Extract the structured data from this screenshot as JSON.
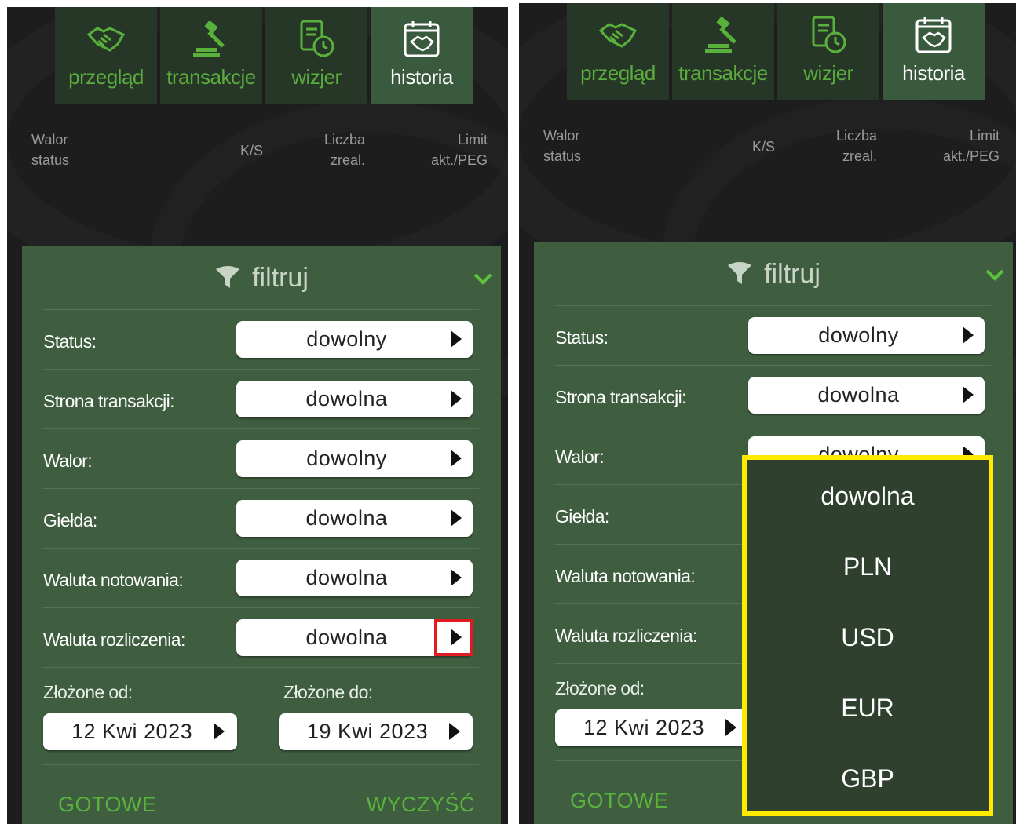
{
  "tabs": [
    {
      "label": "przegląd",
      "icon": "handshake-icon"
    },
    {
      "label": "transakcje",
      "icon": "gavel-icon"
    },
    {
      "label": "wizjer",
      "icon": "document-clock-icon"
    },
    {
      "label": "historia",
      "icon": "calendar-handshake-icon",
      "active": true
    }
  ],
  "columns": {
    "walor": "Walor",
    "status": "status",
    "ks": "K/S",
    "liczba": "Liczba",
    "zreal": "zreal.",
    "limit": "Limit",
    "akt_peg": "akt./PEG"
  },
  "filter": {
    "title": "filtruj",
    "rows": [
      {
        "label": "Status:",
        "value": "dowolny"
      },
      {
        "label": "Strona transakcji:",
        "value": "dowolna"
      },
      {
        "label": "Walor:",
        "value": "dowolny"
      },
      {
        "label": "Giełda:",
        "value": "dowolna"
      },
      {
        "label": "Waluta notowania:",
        "value": "dowolna"
      },
      {
        "label": "Waluta rozliczenia:",
        "value": "dowolna"
      }
    ],
    "from_label": "Złożone od:",
    "to_label": "Złożone do:",
    "from_date": "12 Kwi 2023",
    "to_date": "19 Kwi 2023",
    "done": "GOTOWE",
    "clear": "WYCZYŚĆ"
  },
  "dropdown": {
    "options": [
      "dowolna",
      "PLN",
      "USD",
      "EUR",
      "GBP"
    ]
  },
  "colors": {
    "panel": "#3f5e40",
    "tab_active": "#3a5a3d",
    "accent_green": "#58b23c",
    "highlight_red": "#e11b22",
    "highlight_yellow": "#ffea00",
    "dropdown_bg": "#2f402f"
  }
}
